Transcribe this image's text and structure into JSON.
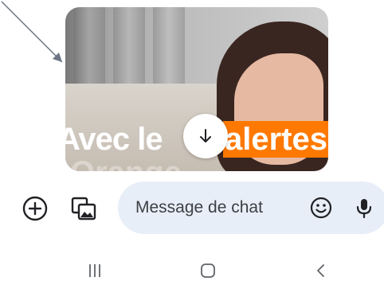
{
  "media": {
    "caption_left": "Avec le",
    "caption_right": "alertes",
    "caption_ghost": "Orange"
  },
  "compose": {
    "message_placeholder": "Message de chat"
  },
  "icons": {
    "add": "plus-circle-icon",
    "gallery": "gallery-image-icon",
    "emoji": "smiley-icon",
    "mic": "microphone-icon",
    "scroll_down": "arrow-down-icon",
    "nav_recent": "recent-apps-icon",
    "nav_home": "home-icon",
    "nav_back": "back-icon"
  },
  "colors": {
    "accent_orange": "#ff7900",
    "input_bg": "#e8eef8"
  }
}
